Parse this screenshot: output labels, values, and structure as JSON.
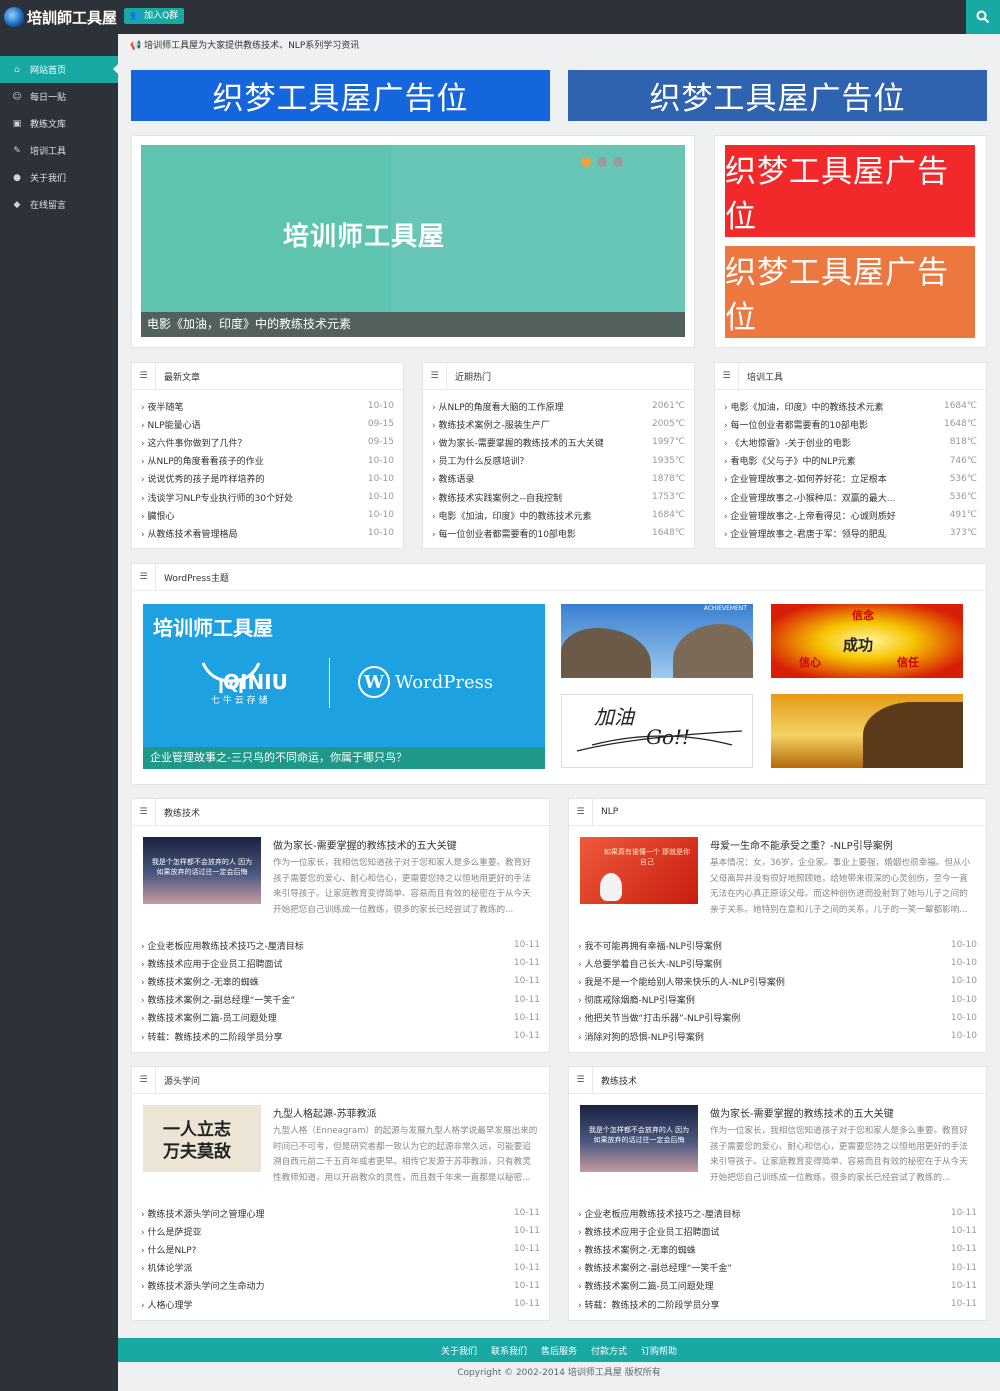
{
  "header": {
    "logo": "培訓師工具屋",
    "qq_button": "加入Q群"
  },
  "sidebar": {
    "items": [
      {
        "label": "网站首页",
        "icon": "home-icon"
      },
      {
        "label": "每日一贴",
        "icon": "smile-icon"
      },
      {
        "label": "教练文库",
        "icon": "image-icon"
      },
      {
        "label": "培训工具",
        "icon": "pencil-icon"
      },
      {
        "label": "关于我们",
        "icon": "user-icon"
      },
      {
        "label": "在线留言",
        "icon": "comment-icon"
      }
    ]
  },
  "notice": "培训师工具屋为大家提供教练技术、NLP系列学习资讯",
  "ads": {
    "banner1": "织梦工具屋广告位",
    "banner2": "织梦工具屋广告位",
    "side1": "织梦工具屋广告位",
    "side2": "织梦工具屋广告位"
  },
  "colors": {
    "accent": "#19a9a4",
    "ad1": "#1565dc",
    "ad2": "#2f63b0",
    "ad3": "#f2292b",
    "ad4": "#ec7840"
  },
  "slider": {
    "brand": "培训师工具屋",
    "caption": "电影《加油，印度》中的教练技术元素"
  },
  "latest": {
    "title": "最新文章",
    "items": [
      {
        "t": "夜半随笔",
        "d": "10-10"
      },
      {
        "t": "NLP能量心语",
        "d": "09-15"
      },
      {
        "t": "这六件事你做到了几件？",
        "d": "09-15"
      },
      {
        "t": "从NLP的角度看看孩子的作业",
        "d": "10-10"
      },
      {
        "t": "说说优秀的孩子是咋样培养的",
        "d": "10-10"
      },
      {
        "t": "浅谈学习NLP专业执行师的30个好处",
        "d": "10-10"
      },
      {
        "t": "臓恨心",
        "d": "10-10"
      },
      {
        "t": "从教练技术看管理格局",
        "d": "10-10"
      }
    ]
  },
  "hot": {
    "title": "近期热门",
    "items": [
      {
        "t": "从NLP的角度看大脑的工作原理",
        "d": "2061℃"
      },
      {
        "t": "教练技术案例之-服装生产厂",
        "d": "2005℃"
      },
      {
        "t": "做为家长-需要掌握的教练技术的五大关键",
        "d": "1997℃"
      },
      {
        "t": "员工为什么反感培训？",
        "d": "1935℃"
      },
      {
        "t": "教练语录",
        "d": "1878℃"
      },
      {
        "t": "教练技术实践案例之--自我控制",
        "d": "1753℃"
      },
      {
        "t": "电影《加油，印度》中的教练技术元素",
        "d": "1684℃"
      },
      {
        "t": "每一位创业者都需要看的10部电影",
        "d": "1648℃"
      }
    ]
  },
  "tools": {
    "title": "培训工具",
    "items": [
      {
        "t": "电影《加油，印度》中的教练技术元素",
        "d": "1684℃"
      },
      {
        "t": "每一位创业者都需要看的10部电影",
        "d": "1648℃"
      },
      {
        "t": "《大地惊雷》-关于创业的电影",
        "d": "818℃"
      },
      {
        "t": "看电影《父与子》中的NLP元素",
        "d": "746℃"
      },
      {
        "t": "企业管理故事之-如何养好花：立足根本",
        "d": "536℃"
      },
      {
        "t": "企业管理故事之-小猴种瓜：双赢的最大...",
        "d": "536℃"
      },
      {
        "t": "企业管理故事之-上帝看得见：心诚则质好",
        "d": "491℃"
      },
      {
        "t": "企业管理故事之-君唐于军：领导的肥乱",
        "d": "373℃"
      }
    ]
  },
  "wp": {
    "title": "WordPress主题",
    "brand": "培训师工具屋",
    "qiniu": "QINIU",
    "qiniu_sub": "七 牛 云 存 储",
    "wordpress": "WordPress",
    "caption": "企业管理故事之-三只鸟的不同命运，你属于哪只鸟？",
    "img1": "ACHIEVEMENT",
    "img2a": "信念",
    "img2b": "成功",
    "img2c": "信心",
    "img2d": "信任",
    "img3a": "加油",
    "img3b": "Go!!"
  },
  "coach": {
    "title": "教练技术",
    "feat_title": "做为家长-需要掌握的教练技术的五大关键",
    "feat_text": "作为一位家长，我相信您知道孩子对于您和家人是多么重要。教育好孩子需要您的爱心、耐心和信心，更需要您持之以恒地用更好的手法来引导孩子。让家庭教育变得简单、容易而且有效的秘密在于从今天开始把您自己训练成一位教练，很多的家长已经尝试了教练的...",
    "thumb_text": "我是个怎样都不会放弃的人 因为如果放弃的话过往一定会后悔",
    "items": [
      {
        "t": "企业老板应用教练技术技巧之-厘清目标",
        "d": "10-11"
      },
      {
        "t": "教练技术应用于企业员工招聘面试",
        "d": "10-11"
      },
      {
        "t": "教练技术案例之-无辜的蜘蛛",
        "d": "10-11"
      },
      {
        "t": "教练技术案例之-副总经理“一笑千金”",
        "d": "10-11"
      },
      {
        "t": "教练技术案例二篇-员工问题处理",
        "d": "10-11"
      },
      {
        "t": "转载：教练技术的二阶段学员分享",
        "d": "10-11"
      }
    ]
  },
  "nlp": {
    "title": "NLP",
    "feat_title": "母爱一生命不能承受之重？-NLP引导案例",
    "feat_text": "基本情况：女，36岁，企业家。事业上要强，婚姻也很幸福。但从小父母离异并没有很好地照顾她，给她带来很深的心灵创伤，至今一直无法在内心真正原谅父母。而这种创伤进而投射到了她与儿子之间的亲子关系。她特别在意和儿子之间的关系，儿子的一笑一颦都影响...",
    "thumb_text": "如果真有谁懂一个 那就是你自己",
    "items": [
      {
        "t": "我不可能再拥有幸福-NLP引导案例",
        "d": "10-10"
      },
      {
        "t": "人总要学着自己长大-NLP引导案例",
        "d": "10-10"
      },
      {
        "t": "我是不是一个能给别人带来快乐的人-NLP引导案例",
        "d": "10-10"
      },
      {
        "t": "彻底戒除烟瘾-NLP引导案例",
        "d": "10-10"
      },
      {
        "t": "他把关节当做“打击乐器”-NLP引导案例",
        "d": "10-10"
      },
      {
        "t": "消除对狗的恐惧-NLP引导案例",
        "d": "10-10"
      }
    ]
  },
  "source": {
    "title": "源头学问",
    "feat_title": "九型人格起源-苏菲教派",
    "feat_text": "九型人格（Enneagram）的起源与发展九型人格学说最早发展出来的时间已不可考，但是研究者都一致认为它的起源非常久远，可能要追溯自西元前二千五百年或者更早。相传它发源于苏菲教派，只有教灵性教师知道，用以开启教众的灵性，而且数千年来一直都是以秘密...",
    "thumb_text": "一人立志 万夫莫敌",
    "items": [
      {
        "t": "教练技术源头学问之管理心理",
        "d": "10-11"
      },
      {
        "t": "什么是萨提亚",
        "d": "10-11"
      },
      {
        "t": "什么是NLP?",
        "d": "10-11"
      },
      {
        "t": "机体论学派",
        "d": "10-11"
      },
      {
        "t": "教练技术源头学问之生命动力",
        "d": "10-11"
      },
      {
        "t": "人格心理学",
        "d": "10-11"
      }
    ]
  },
  "coach2": {
    "title": "教练技术",
    "feat_title": "做为家长-需要掌握的教练技术的五大关键",
    "feat_text": "作为一位家长，我相信您知道孩子对于您和家人是多么重要。教育好孩子需要您的爱心、耐心和信心，更需要您持之以恒地用更好的手法来引导孩子。让家庭教育变得简单、容易而且有效的秘密在于从今天开始把您自己训练成一位教练，很多的家长已经尝试了教练的...",
    "thumb_text": "我是个怎样都不会放弃的人 因为如果放弃的话过往一定会后悔",
    "items": [
      {
        "t": "企业老板应用教练技术技巧之-厘清目标",
        "d": "10-11"
      },
      {
        "t": "教练技术应用于企业员工招聘面试",
        "d": "10-11"
      },
      {
        "t": "教练技术案例之-无辜的蜘蛛",
        "d": "10-11"
      },
      {
        "t": "教练技术案例之-副总经理“一笑千金”",
        "d": "10-11"
      },
      {
        "t": "教练技术案例二篇-员工问题处理",
        "d": "10-11"
      },
      {
        "t": "转载：教练技术的二阶段学员分享",
        "d": "10-11"
      }
    ]
  },
  "footer": {
    "links": [
      "关于我们",
      "联系我们",
      "售后服务",
      "付款方式",
      "订购帮助"
    ],
    "copyright": "Copyright © 2002-2014 培训师工具屋 版权所有"
  }
}
